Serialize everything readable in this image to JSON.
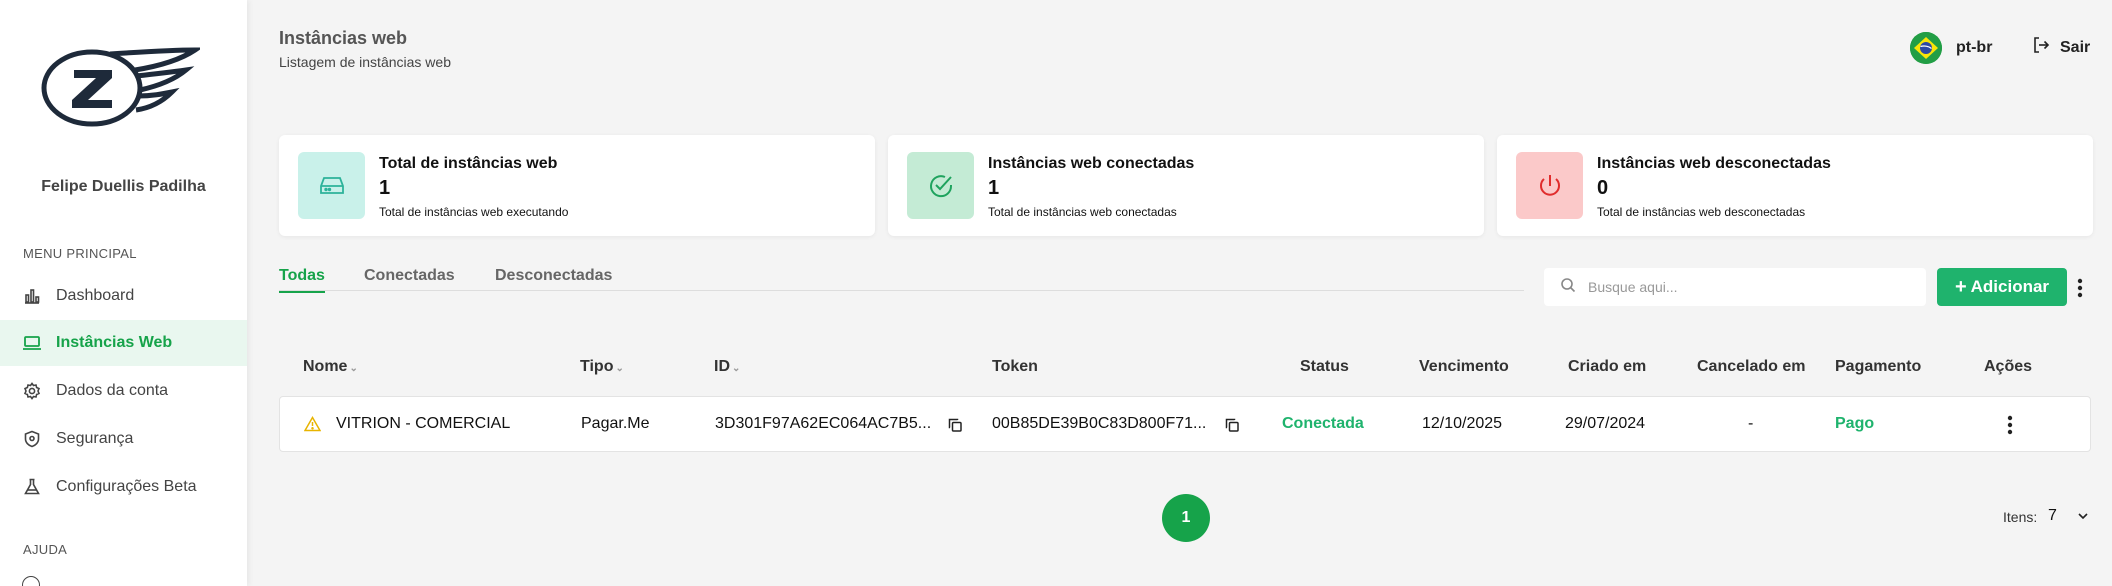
{
  "sidebar": {
    "user_name": "Felipe Duellis Padilha",
    "menu_label": "MENU PRINCIPAL",
    "help_label": "AJUDA",
    "items": [
      {
        "label": "Dashboard",
        "icon": "bar-chart-icon",
        "active": false
      },
      {
        "label": "Instâncias Web",
        "icon": "laptop-icon",
        "active": true
      },
      {
        "label": "Dados da conta",
        "icon": "gear-icon",
        "active": false
      },
      {
        "label": "Segurança",
        "icon": "shield-icon",
        "active": false
      },
      {
        "label": "Configurações Beta",
        "icon": "flask-icon",
        "active": false
      }
    ]
  },
  "header": {
    "title": "Instâncias web",
    "subtitle": "Listagem de instâncias web",
    "language": "pt-br",
    "logout_label": "Sair"
  },
  "cards": [
    {
      "title": "Total de instâncias web",
      "value": "1",
      "description": "Total de instâncias web executando",
      "icon": "server-icon",
      "color": "#c9f1ea"
    },
    {
      "title": "Instâncias web conectadas",
      "value": "1",
      "description": "Total de instâncias web conectadas",
      "icon": "check-circle-icon",
      "color": "#c4ebd5"
    },
    {
      "title": "Instâncias web desconectadas",
      "value": "0",
      "description": "Total de instâncias web desconectadas",
      "icon": "power-icon",
      "color": "#fbc9c9"
    }
  ],
  "tabs": [
    {
      "label": "Todas",
      "active": true
    },
    {
      "label": "Conectadas",
      "active": false
    },
    {
      "label": "Desconectadas",
      "active": false
    }
  ],
  "search": {
    "placeholder": "Busque aqui..."
  },
  "add_button": {
    "label": "Adicionar"
  },
  "table": {
    "columns": [
      "Nome",
      "Tipo",
      "ID",
      "Token",
      "Status",
      "Vencimento",
      "Criado em",
      "Cancelado em",
      "Pagamento",
      "Ações"
    ],
    "rows": [
      {
        "nome": "VITRION - COMERCIAL",
        "tipo": "Pagar.Me",
        "id": "3D301F97A62EC064AC7B5...",
        "token": "00B85DE39B0C83D800F71...",
        "status": "Conectada",
        "vencimento": "12/10/2025",
        "criado_em": "29/07/2024",
        "cancelado_em": "-",
        "pagamento": "Pago"
      }
    ]
  },
  "pagination": {
    "current_page": "1",
    "items_label": "Itens:",
    "items_value": "7"
  },
  "colors": {
    "accent": "#16a34a",
    "button": "#1fb36d",
    "warning": "#e8b400"
  }
}
